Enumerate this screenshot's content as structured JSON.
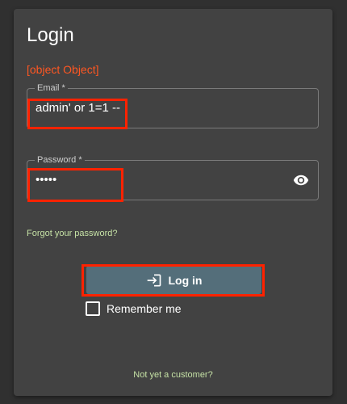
{
  "login_form": {
    "title": "Login",
    "error_message": "[object Object]",
    "email": {
      "label": "Email *",
      "value": "admin' or 1=1 --"
    },
    "password": {
      "label": "Password *",
      "masked_value": "•••••",
      "visibility_icon": "eye-icon"
    },
    "forgot_password_link": "Forgot your password?",
    "login_button": {
      "label": "Log in",
      "icon": "login-icon"
    },
    "remember_me": {
      "label": "Remember me",
      "checked": false
    },
    "register_link": "Not yet a customer?"
  },
  "colors": {
    "background": "#303030",
    "card": "#424242",
    "error": "#ff5722",
    "link": "#c5e1a5",
    "button": "#546e7a",
    "highlight": "#ff2200"
  }
}
